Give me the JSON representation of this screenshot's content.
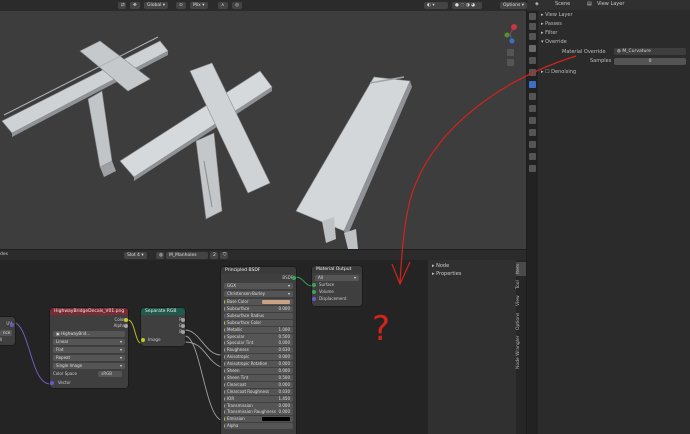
{
  "viewport": {
    "header": {
      "orientation": "Global",
      "pivot": "Mix",
      "options": "Options"
    }
  },
  "properties": {
    "header": {
      "scene": "Scene",
      "view_layer": "View Layer"
    },
    "sections": {
      "view_layer": "View Layer",
      "passes": "Passes",
      "filter": "Filter",
      "override": "Override",
      "denoising": "Denoising"
    },
    "material_override_label": "Material Override",
    "material_override_value": "M_Curvature",
    "samples_label": "Samples",
    "samples_value": "0"
  },
  "node_editor": {
    "header": {
      "left_label": "des",
      "slot": "Slot 4",
      "material": "M_Manholes",
      "users": "2"
    },
    "sidebar": {
      "node": "Node",
      "properties": "Properties"
    },
    "tabs": [
      "Item",
      "Tool",
      "View",
      "Options",
      "Node Wrangler"
    ],
    "left_node": {
      "out_uv": "UV",
      "field_a": "nce",
      "field_b": "ll"
    },
    "image_node": {
      "title": "HighwayBridgeDecals_V01.png",
      "out_color": "Color",
      "out_alpha": "Alpha",
      "image_name": "HighwayBrid...",
      "interpolation": "Linear",
      "projection": "Flat",
      "extension": "Repeat",
      "source": "Single Image",
      "color_space_label": "Color Space",
      "color_space_value": "sRGB",
      "in_vector": "Vector"
    },
    "separate_node": {
      "title": "Separate RGB",
      "out_r": "R",
      "out_g": "G",
      "out_b": "B",
      "in_image": "Image"
    },
    "principled": {
      "title": "Principled BSDF",
      "out_bsdf": "BSDF",
      "distribution": "GGX",
      "subsurface_method": "Christensen-Burley",
      "rows": [
        {
          "label": "Base Color",
          "value": ""
        },
        {
          "label": "Subsurface",
          "value": "0.000"
        },
        {
          "label": "Subsurface Radius",
          "value": ""
        },
        {
          "label": "Subsurface Color",
          "value": ""
        },
        {
          "label": "Metallic",
          "value": "1.000"
        },
        {
          "label": "Specular",
          "value": "0.500"
        },
        {
          "label": "Specular Tint",
          "value": "0.000"
        },
        {
          "label": "Roughness",
          "value": "0.630"
        },
        {
          "label": "Anisotropic",
          "value": "0.000"
        },
        {
          "label": "Anisotropic Rotation",
          "value": "0.000"
        },
        {
          "label": "Sheen",
          "value": "0.000"
        },
        {
          "label": "Sheen Tint",
          "value": "0.500"
        },
        {
          "label": "Clearcoat",
          "value": "0.000"
        },
        {
          "label": "Clearcoat Roughness",
          "value": "0.030"
        },
        {
          "label": "IOR",
          "value": "1.450"
        },
        {
          "label": "Transmission",
          "value": "0.000"
        },
        {
          "label": "Transmission Roughness",
          "value": "0.000"
        },
        {
          "label": "Emission",
          "value": ""
        },
        {
          "label": "Alpha",
          "value": ""
        }
      ]
    },
    "material_output": {
      "title": "Material Output",
      "target": "All",
      "in_surface": "Surface",
      "in_volume": "Volume",
      "in_displacement": "Displacement"
    },
    "annotation": "?"
  },
  "colors": {
    "annotation_red": "#d0241c",
    "image_header": "#7a2a32",
    "separate_header": "#1f5a4a",
    "bsdf_header": "#3a3a3a",
    "output_header": "#3a3a3a",
    "base_color_swatch": "#c9a184"
  }
}
